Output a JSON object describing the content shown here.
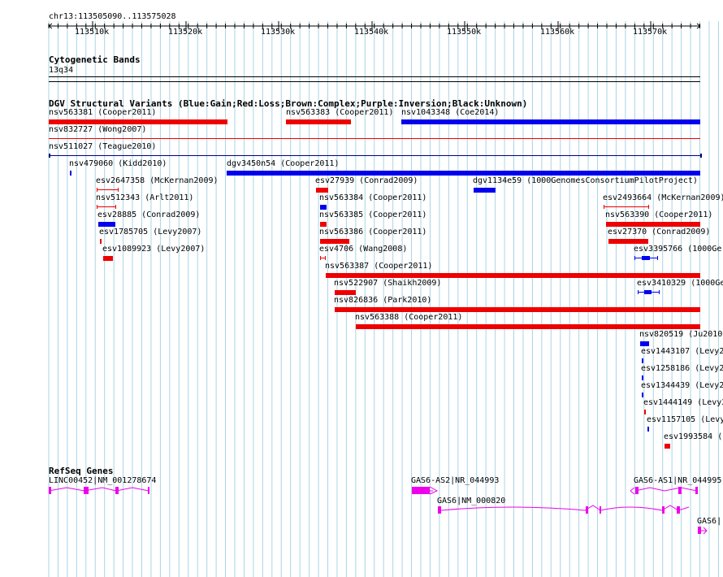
{
  "ruler": {
    "location": "chr13:113505090..113575028",
    "ticks": [
      "113510k",
      "113520k",
      "113530k",
      "113540k",
      "113550k",
      "113560k",
      "113570k"
    ]
  },
  "tracks": {
    "cyto_title": "Cytogenetic Bands",
    "cyto_band": "13q34",
    "dgv_title": "DGV Structural Variants (Blue:Gain;Red:Loss;Brown:Complex;Purple:Inversion;Black:Unknown)",
    "refseq_title": "RefSeq Genes"
  },
  "colors": {
    "gain": "#0000ee",
    "loss": "#ee0000",
    "unknown": "#000080",
    "gene": "#ee00ee",
    "grid": "#aad4e6"
  },
  "variants": [
    {
      "label": "nsv563381 (Cooper2011)",
      "type": "loss"
    },
    {
      "label": "nsv563383 (Cooper2011)",
      "type": "loss"
    },
    {
      "label": "nsv1043348 (Coe2014)",
      "type": "gain"
    },
    {
      "label": "nsv832727 (Wong2007)",
      "type": "loss"
    },
    {
      "label": "nsv511027 (Teague2010)",
      "type": "unknown"
    },
    {
      "label": "nsv479060 (Kidd2010)",
      "type": "gain"
    },
    {
      "label": "dgv3450n54 (Cooper2011)",
      "type": "gain"
    },
    {
      "label": "esv2647358 (McKernan2009)",
      "type": "loss"
    },
    {
      "label": "esv27939 (Conrad2009)",
      "type": "loss"
    },
    {
      "label": "dgv1134e59 (1000GenomesConsortiumPilotProject)",
      "type": "gain"
    },
    {
      "label": "nsv512343 (Arlt2011)",
      "type": "loss"
    },
    {
      "label": "nsv563384 (Cooper2011)",
      "type": "gain"
    },
    {
      "label": "esv2493664 (McKernan2009)",
      "type": "loss"
    },
    {
      "label": "esv28885 (Conrad2009)",
      "type": "gain"
    },
    {
      "label": "nsv563385 (Cooper2011)",
      "type": "loss"
    },
    {
      "label": "nsv563390 (Cooper2011)",
      "type": "loss"
    },
    {
      "label": "esv1785705 (Levy2007)",
      "type": "loss"
    },
    {
      "label": "nsv563386 (Cooper2011)",
      "type": "loss"
    },
    {
      "label": "esv27370 (Conrad2009)",
      "type": "loss"
    },
    {
      "label": "esv1089923 (Levy2007)",
      "type": "loss"
    },
    {
      "label": "esv4706 (Wang2008)",
      "type": "loss"
    },
    {
      "label": "esv3395766 (1000Ger",
      "type": "gain"
    },
    {
      "label": "nsv563387 (Cooper2011)",
      "type": "loss"
    },
    {
      "label": "nsv522907 (Shaikh2009)",
      "type": "loss"
    },
    {
      "label": "esv3410329 (1000Ge",
      "type": "gain"
    },
    {
      "label": "nsv826836 (Park2010)",
      "type": "loss"
    },
    {
      "label": "nsv563388 (Cooper2011)",
      "type": "loss"
    },
    {
      "label": "nsv820519 (Ju2010",
      "type": "gain"
    },
    {
      "label": "esv1443107 (Levy2",
      "type": "gain"
    },
    {
      "label": "esv1258186 (Levy2",
      "type": "gain"
    },
    {
      "label": "esv1344439 (Levy2",
      "type": "gain"
    },
    {
      "label": "esv1444149 (Levy2",
      "type": "loss"
    },
    {
      "label": "esv1157105 (Levy",
      "type": "gain"
    },
    {
      "label": "esv1993584 (",
      "type": "loss"
    }
  ],
  "genes": [
    {
      "label": "LINC00452|NM_001278674"
    },
    {
      "label": "GAS6-AS2|NR_044993"
    },
    {
      "label": "GAS6-AS1|NR_044995"
    },
    {
      "label": "GAS6|NM_000820"
    },
    {
      "label": "GAS6|"
    }
  ]
}
